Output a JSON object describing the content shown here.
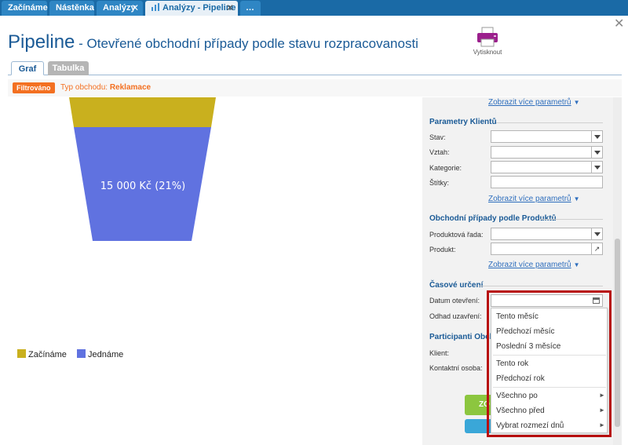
{
  "tabs": [
    {
      "label": "Začínáme"
    },
    {
      "label": "Nástěnka"
    },
    {
      "label": "Analýzy",
      "close": "✕"
    },
    {
      "label": "Analýzy - Pipeline",
      "close": "✕"
    },
    {
      "label": "…"
    }
  ],
  "window_close": "✕",
  "title": {
    "main": "Pipeline",
    "sub": " - Otevřené obchodní případy podle stavu rozpracovanosti"
  },
  "print_label": "Vytisknout",
  "subtabs": [
    "Graf",
    "Tabulka"
  ],
  "filter": {
    "badge": "Filtrováno",
    "label": "Typ obchodu:",
    "value": "Reklamace"
  },
  "chart_data": {
    "type": "funnel",
    "series": [
      {
        "name": "Začínáme",
        "color": "#c9b01e"
      },
      {
        "name": "Jednáme",
        "color": "#6072e0",
        "label": "15 000 Kč (21%)"
      }
    ]
  },
  "panel": {
    "more_link": "Zobrazit více parametrů",
    "sections": {
      "klienti": "Parametry Klientů",
      "produkty": "Obchodní případy podle Produktů",
      "casove": "Časové určení",
      "participanti": "Participanti Obcho"
    },
    "fields": {
      "stav": "Stav:",
      "vztah": "Vztah:",
      "kategorie": "Kategorie:",
      "stitky": "Štítky:",
      "produktova_rada": "Produktová řada:",
      "produkt": "Produkt:",
      "datum_otevreni": "Datum otevření:",
      "odhad_uzavreni": "Odhad uzavření:",
      "klient": "Klient:",
      "kontaktni_osoba": "Kontaktní osoba:"
    },
    "button_green": "ZO"
  },
  "date_menu": {
    "items": [
      "Tento měsíc",
      "Předchozí měsíc",
      "Poslední 3 měsíce",
      "Tento rok",
      "Předchozí rok",
      "Všechno po",
      "Všechno před",
      "Vybrat rozmezí dnů"
    ],
    "arrow": "►"
  },
  "colors": {
    "tab_bar": "#1a6aa6",
    "accent": "#1a5a96",
    "filter": "#f37021",
    "highlight": "#b80f0f"
  }
}
